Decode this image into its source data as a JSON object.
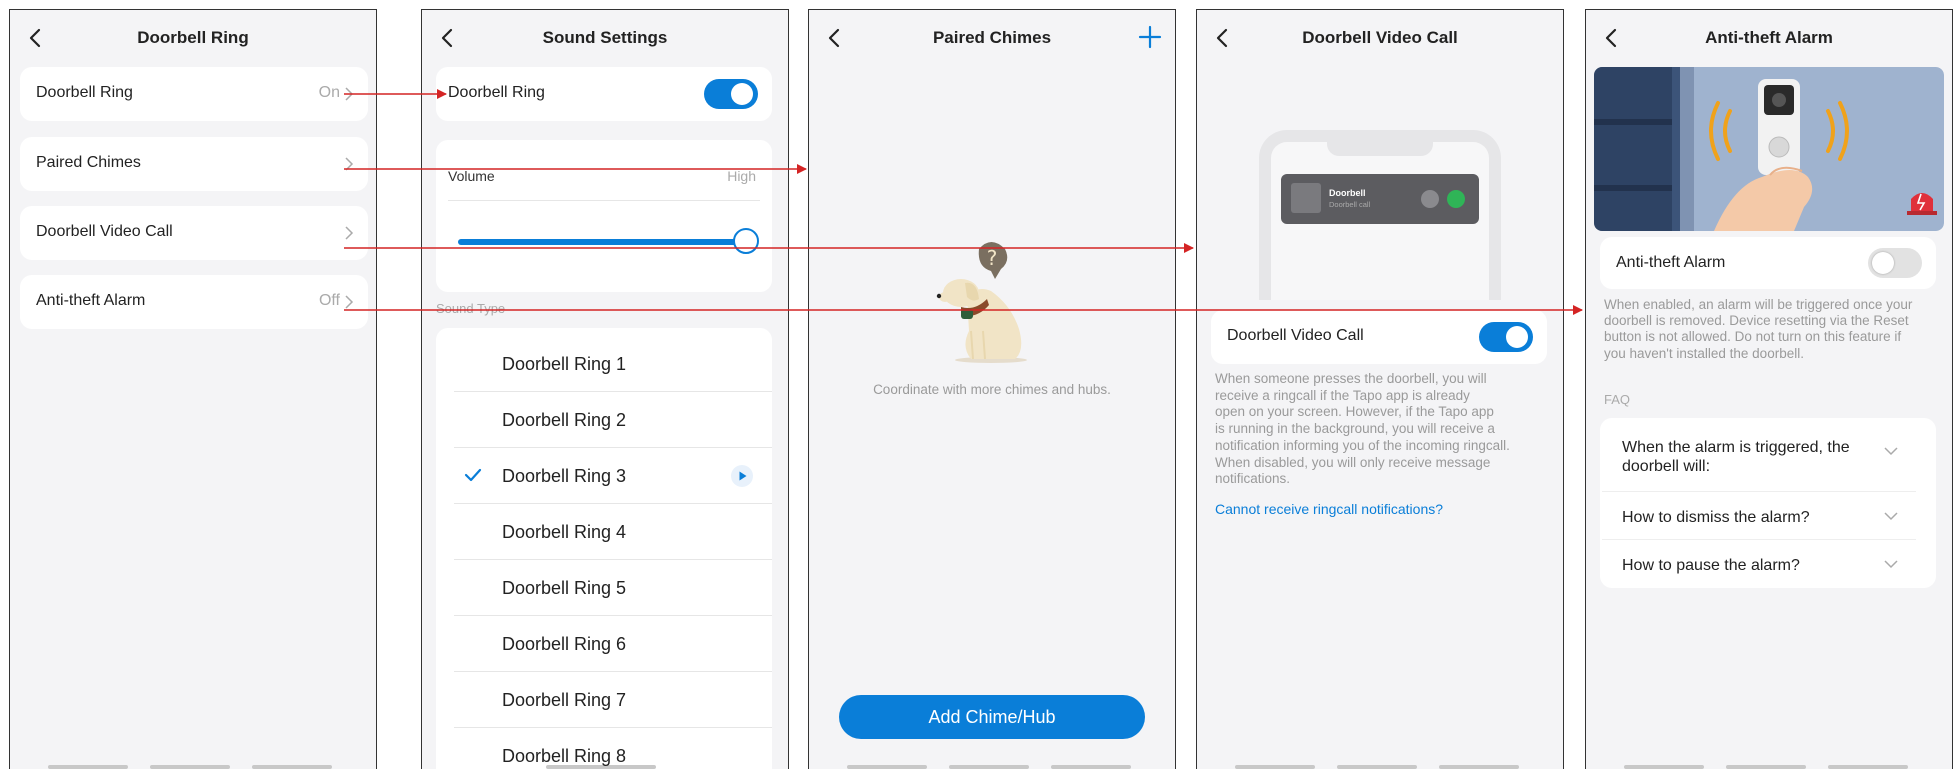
{
  "screens": {
    "doorbell_ring": {
      "title": "Doorbell Ring",
      "rows": [
        {
          "label": "Doorbell Ring",
          "value": "On"
        },
        {
          "label": "Paired Chimes",
          "value": ""
        },
        {
          "label": "Doorbell Video Call",
          "value": ""
        },
        {
          "label": "Anti-theft Alarm",
          "value": "Off"
        }
      ]
    },
    "sound_settings": {
      "title": "Sound Settings",
      "toggle_label": "Doorbell Ring",
      "toggle_on": true,
      "volume_label": "Volume",
      "volume_value": "High",
      "volume_level": 1.0,
      "section_label": "Sound Type",
      "rings": [
        "Doorbell Ring 1",
        "Doorbell Ring 2",
        "Doorbell Ring 3",
        "Doorbell Ring 4",
        "Doorbell Ring 5",
        "Doorbell Ring 6",
        "Doorbell Ring 7",
        "Doorbell Ring 8"
      ],
      "selected_ring": 2
    },
    "paired_chimes": {
      "title": "Paired Chimes",
      "empty_text": "Coordinate with more chimes and hubs.",
      "button_label": "Add Chime/Hub"
    },
    "video_call": {
      "title": "Doorbell Video Call",
      "call_title": "Doorbell",
      "call_subtitle": "Doorbell call",
      "toggle_label": "Doorbell Video Call",
      "toggle_on": true,
      "desc_lines": [
        "When someone presses the doorbell, you will",
        "receive a ringcall if the Tapo app is already",
        "open on your screen. However, if the Tapo app",
        "is running in the background, you will receive a",
        "notification informing you of the incoming ringcall.",
        "When disabled, you will only receive message",
        "notifications."
      ],
      "link": "Cannot receive ringcall notifications?"
    },
    "anti_theft": {
      "title": "Anti-theft Alarm",
      "toggle_label": "Anti-theft Alarm",
      "toggle_on": false,
      "desc_lines": [
        "When enabled, an alarm will be triggered once your",
        "doorbell is removed. Device resetting via the Reset",
        "button is not allowed. Do not turn on this feature if",
        "you haven't installed the doorbell."
      ],
      "faq_label": "FAQ",
      "faq": [
        {
          "line1": "When the alarm is triggered, the",
          "line2": "doorbell will:"
        },
        {
          "line1": "How to dismiss the alarm?",
          "line2": ""
        },
        {
          "line1": "How to pause the alarm?",
          "line2": ""
        }
      ]
    }
  },
  "colors": {
    "accent": "#0a7ed8",
    "arrow": "#d42424",
    "background": "#f4f4f6",
    "card": "#ffffff",
    "muted_text": "#9a9a9a"
  }
}
